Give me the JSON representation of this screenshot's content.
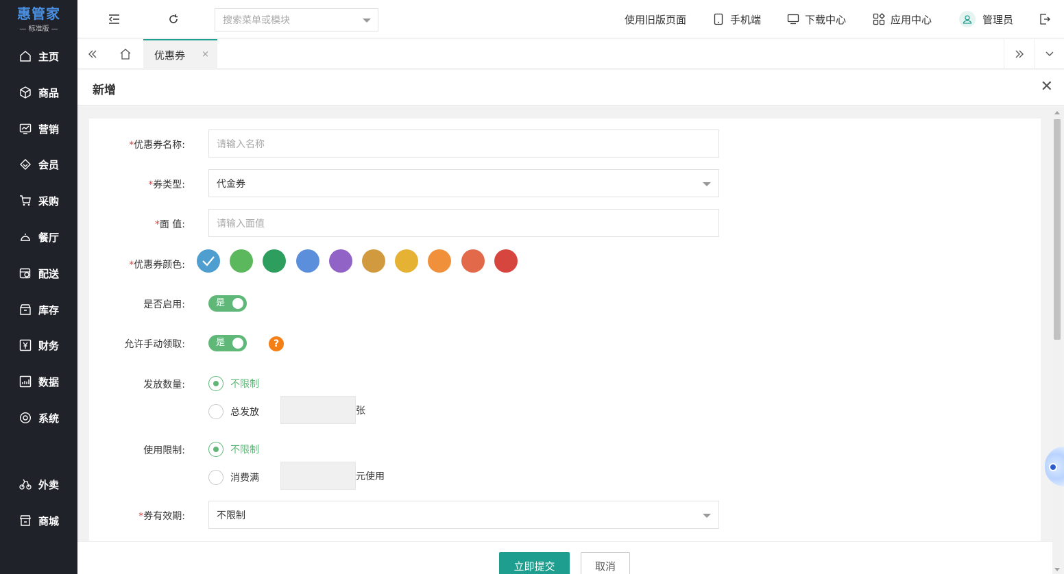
{
  "logo": {
    "title": "惠管家",
    "subtitle": "— 标准版 —"
  },
  "sidebar": {
    "items": [
      {
        "label": "主页",
        "icon": "home-icon"
      },
      {
        "label": "商品",
        "icon": "box-icon"
      },
      {
        "label": "营销",
        "icon": "chart-icon"
      },
      {
        "label": "会员",
        "icon": "diamond-icon"
      },
      {
        "label": "采购",
        "icon": "cart-icon"
      },
      {
        "label": "餐厅",
        "icon": "bell-icon"
      },
      {
        "label": "配送",
        "icon": "delivery-icon"
      },
      {
        "label": "库存",
        "icon": "inventory-icon"
      },
      {
        "label": "财务",
        "icon": "yuan-icon"
      },
      {
        "label": "数据",
        "icon": "data-icon"
      },
      {
        "label": "系统",
        "icon": "settings-icon"
      },
      {
        "label": "外卖",
        "icon": "bike-icon"
      },
      {
        "label": "商城",
        "icon": "shop-icon"
      }
    ]
  },
  "header": {
    "search_placeholder": "搜索菜单或模块",
    "old_version": "使用旧版页面",
    "mobile": "手机端",
    "download": "下载中心",
    "apps": "应用中心",
    "user": "管理员"
  },
  "tabs": {
    "active": "优惠券",
    "close": "×"
  },
  "dialog": {
    "title": "新增",
    "close": "✕",
    "form": {
      "name": {
        "label": "优惠券名称:",
        "placeholder": "请输入名称"
      },
      "type": {
        "label": "券类型:",
        "value": "代金券"
      },
      "face_value": {
        "label": "面 值:",
        "placeholder": "请输入面值"
      },
      "color": {
        "label": "优惠券颜色:",
        "options": [
          "#4e9ed0",
          "#5cb85c",
          "#2e9e5f",
          "#5b8fdc",
          "#9163c7",
          "#d19a3f",
          "#e6b234",
          "#f0903a",
          "#e26a4a",
          "#d6453e"
        ],
        "selected_index": 0
      },
      "enabled": {
        "label": "是否启用:",
        "value": "是"
      },
      "manual_claim": {
        "label": "允许手动领取:",
        "value": "是",
        "help": "?"
      },
      "quantity": {
        "label": "发放数量:",
        "options": [
          "不限制",
          "总发放"
        ],
        "selected_index": 0,
        "unit": "张"
      },
      "usage_limit": {
        "label": "使用限制:",
        "options": [
          "不限制",
          "消费满"
        ],
        "selected_index": 0,
        "unit": "元使用"
      },
      "validity": {
        "label": "券有效期:",
        "value": "不限制"
      }
    },
    "submit": "立即提交",
    "cancel": "取消"
  }
}
